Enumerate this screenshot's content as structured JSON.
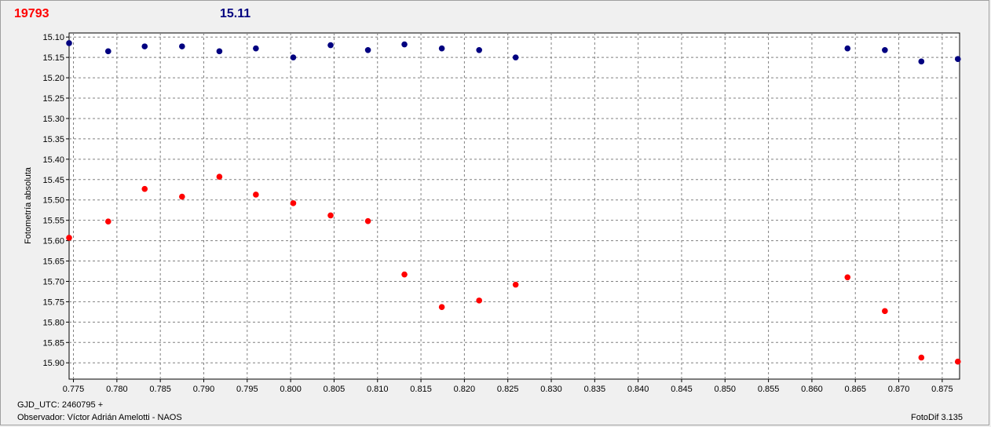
{
  "header": {
    "object_label": "19793",
    "comparison_label": "15.11"
  },
  "footer": {
    "gjd": "GJD_UTC: 2460795 +",
    "observer": "Observador: Víctor Adrián Amelotti - NAOS",
    "version": "FotoDif 3.135"
  },
  "colors": {
    "series_red": "#ff0000",
    "series_blue": "#000080",
    "grid": "#808080",
    "plot_bg": "#ffffff"
  },
  "chart_data": {
    "type": "scatter",
    "title": "",
    "xlabel": "",
    "ylabel": "Fotometría absoluta",
    "xlim": [
      0.7745,
      0.877
    ],
    "ylim": [
      15.09,
      15.94
    ],
    "y_inverted": true,
    "grid": true,
    "x_ticks": [
      "0.775",
      "0.780",
      "0.785",
      "0.790",
      "0.795",
      "0.800",
      "0.805",
      "0.810",
      "0.815",
      "0.820",
      "0.825",
      "0.830",
      "0.835",
      "0.840",
      "0.845",
      "0.850",
      "0.855",
      "0.860",
      "0.865",
      "0.870",
      "0.875"
    ],
    "y_ticks": [
      "15.10",
      "15.15",
      "15.20",
      "15.25",
      "15.30",
      "15.35",
      "15.40",
      "15.45",
      "15.50",
      "15.55",
      "15.60",
      "15.65",
      "15.70",
      "15.75",
      "15.80",
      "15.85",
      "15.90"
    ],
    "series": [
      {
        "color": "#000080",
        "x": [
          0.7745,
          0.779,
          0.7832,
          0.7875,
          0.7918,
          0.796,
          0.8003,
          0.8046,
          0.8089,
          0.8131,
          0.8174,
          0.8217,
          0.8259,
          0.8641,
          0.8684,
          0.8726,
          0.8768
        ],
        "y": [
          15.115,
          15.135,
          15.123,
          15.123,
          15.135,
          15.128,
          15.15,
          15.12,
          15.132,
          15.118,
          15.128,
          15.132,
          15.15,
          15.128,
          15.132,
          15.16,
          15.154
        ]
      },
      {
        "color": "#ff0000",
        "x": [
          0.7745,
          0.779,
          0.7832,
          0.7875,
          0.7918,
          0.796,
          0.8003,
          0.8046,
          0.8089,
          0.8131,
          0.8174,
          0.8217,
          0.8259,
          0.8641,
          0.8684,
          0.8726,
          0.8768
        ],
        "y": [
          15.593,
          15.553,
          15.473,
          15.492,
          15.443,
          15.487,
          15.508,
          15.538,
          15.552,
          15.683,
          15.763,
          15.747,
          15.708,
          15.69,
          15.773,
          15.887,
          15.897
        ]
      }
    ]
  }
}
